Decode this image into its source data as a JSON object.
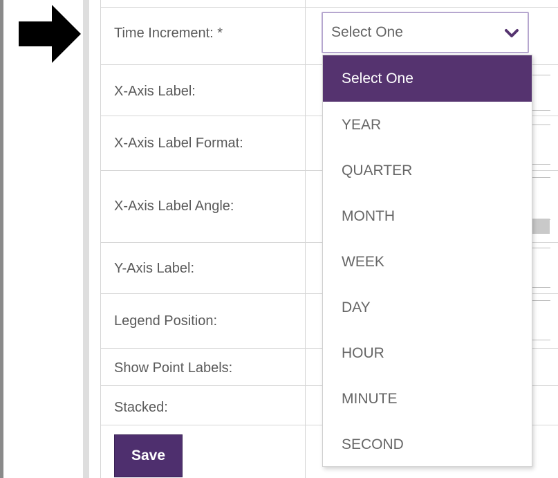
{
  "form": {
    "labels": {
      "time_increment": "Time Increment: *",
      "x_axis_label": "X-Axis Label:",
      "x_axis_label_format": "X-Axis Label Format:",
      "x_axis_label_angle": "X-Axis Label Angle:",
      "y_axis_label": "Y-Axis Label:",
      "legend_position": "Legend Position:",
      "show_point_labels": "Show Point Labels:",
      "stacked": "Stacked:"
    },
    "save_label": "Save"
  },
  "time_increment_select": {
    "selected": "Select One",
    "options": [
      "Select One",
      "YEAR",
      "QUARTER",
      "MONTH",
      "WEEK",
      "DAY",
      "HOUR",
      "MINUTE",
      "SECOND"
    ]
  },
  "colors": {
    "accent": "#55336f",
    "select_border": "#b6a7cf",
    "save_button": "#4e2f6e"
  }
}
